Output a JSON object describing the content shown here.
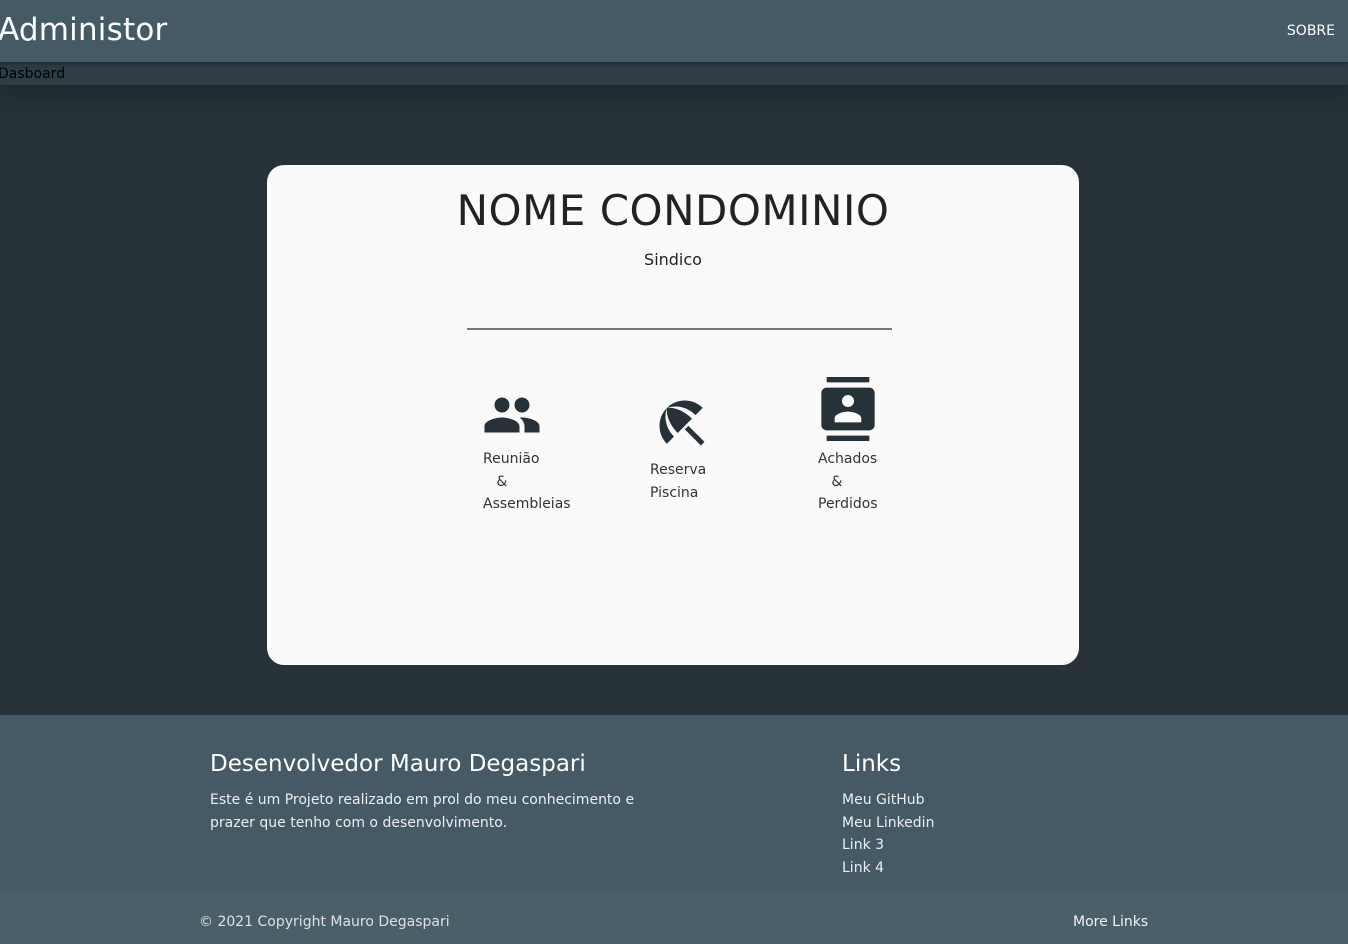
{
  "navbar": {
    "brand": "Administor",
    "link": "SOBRE"
  },
  "breadcrumb": "Dasboard",
  "card": {
    "title": "NOME CONDOMINIO",
    "subtitle": "Sindico",
    "tiles": [
      {
        "icon": "people-icon",
        "label": "Reunião\n   &\nAssembleias"
      },
      {
        "icon": "beach-umbrella-icon",
        "label": "Reserva\nPiscina"
      },
      {
        "icon": "contact-card-icon",
        "label": "Achados\n   &\nPerdidos"
      }
    ]
  },
  "footer": {
    "title": "Desenvolvedor Mauro Degaspari",
    "description": "Este é um Projeto realizado em prol do meu conhecimento e prazer que tenho com o desenvolvimento.",
    "links_title": "Links",
    "links": [
      "Meu GitHub",
      "Meu Linkedin",
      "Link 3",
      "Link 4"
    ],
    "copyright": "© 2021 Copyright Mauro Degaspari",
    "more_links": "More Links"
  },
  "colors": {
    "navbar": "#455a64",
    "background": "#263238",
    "card": "#fafafa",
    "icon": "#263238"
  }
}
